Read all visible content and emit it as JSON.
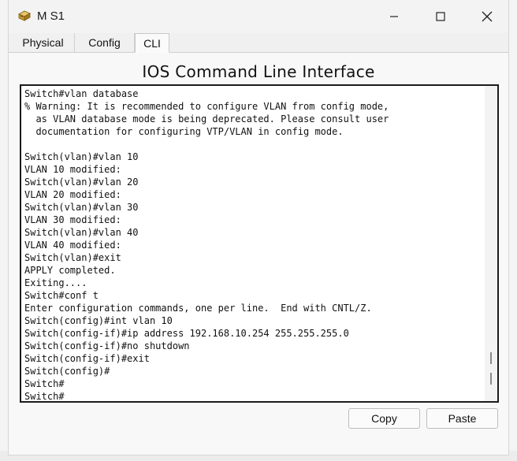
{
  "window": {
    "title": "M S1",
    "icon": "switch-device-icon",
    "controls": [
      "minimize-icon",
      "maximize-icon",
      "close-icon"
    ]
  },
  "tabs": [
    {
      "label": "Physical",
      "active": false
    },
    {
      "label": "Config",
      "active": false
    },
    {
      "label": "CLI",
      "active": true
    }
  ],
  "cli": {
    "heading": "IOS Command Line Interface",
    "lines": [
      "Switch#vlan database",
      "% Warning: It is recommended to configure VLAN from config mode,",
      "  as VLAN database mode is being deprecated. Please consult user",
      "  documentation for configuring VTP/VLAN in config mode.",
      "",
      "Switch(vlan)#vlan 10",
      "VLAN 10 modified:",
      "Switch(vlan)#vlan 20",
      "VLAN 20 modified:",
      "Switch(vlan)#vlan 30",
      "VLAN 30 modified:",
      "Switch(vlan)#vlan 40",
      "VLAN 40 modified:",
      "Switch(vlan)#exit",
      "APPLY completed.",
      "Exiting....",
      "Switch#conf t",
      "Enter configuration commands, one per line.  End with CNTL/Z.",
      "Switch(config)#int vlan 10",
      "Switch(config-if)#ip address 192.168.10.254 255.255.255.0",
      "Switch(config-if)#no shutdown",
      "Switch(config-if)#exit",
      "Switch(config)#",
      "Switch#",
      "Switch#"
    ]
  },
  "buttons": {
    "copy": "Copy",
    "paste": "Paste"
  }
}
